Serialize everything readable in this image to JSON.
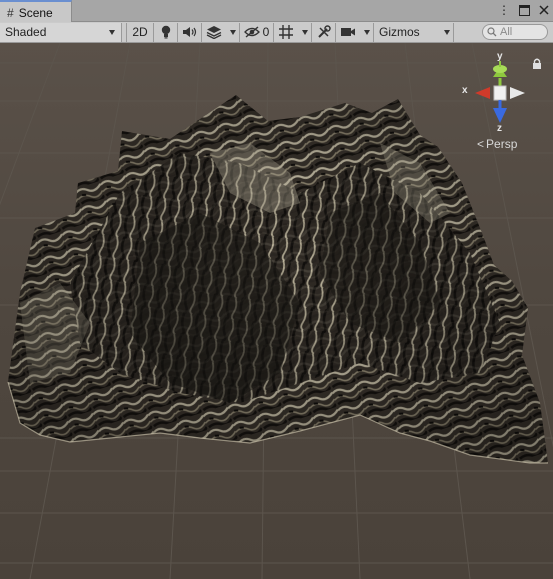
{
  "window": {
    "tab_label": "Scene",
    "tab_icon": "grid-icon"
  },
  "toolbar": {
    "draw_mode": "Shaded",
    "mode_2d_label": "2D",
    "hidden_count": "0",
    "gizmos_label": "Gizmos",
    "search_placeholder": "All"
  },
  "gizmo": {
    "x_label": "x",
    "y_label": "y",
    "z_label": "z",
    "projection_label": "Persp",
    "colors": {
      "x": "#d03a2a",
      "y": "#8ec83e",
      "z": "#3a6ae0",
      "neutral": "#e8e8e8"
    }
  },
  "colors": {
    "viewport_bg": "#4a423a",
    "terrain_light": "#b8b09a",
    "terrain_dark": "#181512",
    "grid_line": "#5c554d"
  }
}
